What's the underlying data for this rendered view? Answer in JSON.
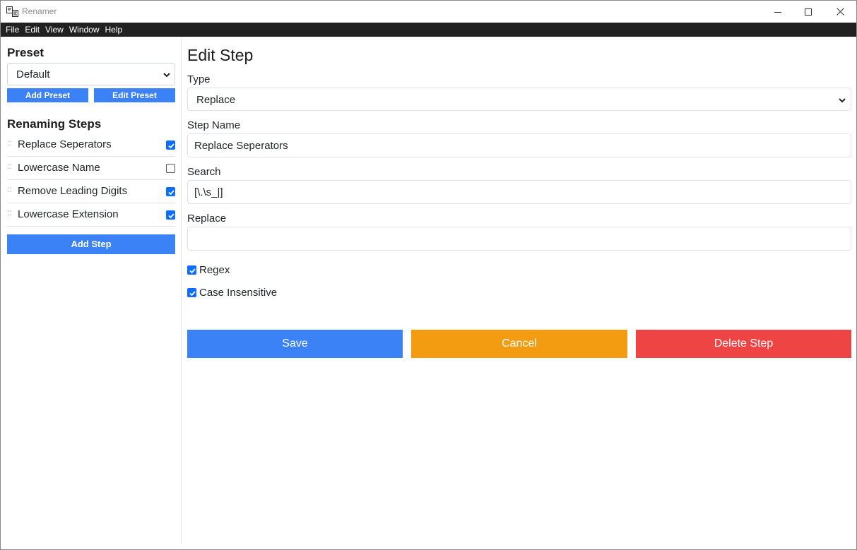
{
  "window": {
    "title": "Renamer",
    "accent_color": "#3b82f6",
    "menubar_color": "#212121"
  },
  "menu": {
    "items": [
      "File",
      "Edit",
      "View",
      "Window",
      "Help"
    ]
  },
  "sidebar": {
    "preset_heading": "Preset",
    "preset_selected": "Default",
    "add_preset_label": "Add Preset",
    "edit_preset_label": "Edit Preset",
    "steps_heading": "Renaming Steps",
    "steps": [
      {
        "label": "Replace Seperators",
        "checked": true
      },
      {
        "label": "Lowercase Name",
        "checked": false
      },
      {
        "label": "Remove Leading Digits",
        "checked": true
      },
      {
        "label": "Lowercase Extension",
        "checked": true
      }
    ],
    "grip_glyph": "::",
    "add_step_label": "Add Step"
  },
  "edit_step": {
    "heading": "Edit Step",
    "type_label": "Type",
    "type_value": "Replace",
    "name_label": "Step Name",
    "name_value": "Replace Seperators",
    "search_label": "Search",
    "search_value": "[\\.\\s_|]",
    "replace_label": "Replace",
    "replace_value": "",
    "regex_label": "Regex",
    "regex_checked": true,
    "case_label": "Case Insensitive",
    "case_checked": true,
    "save_label": "Save",
    "cancel_label": "Cancel",
    "delete_label": "Delete Step",
    "colors": {
      "save": "#3b82f6",
      "cancel": "#f39c12",
      "delete": "#ef4444"
    }
  }
}
